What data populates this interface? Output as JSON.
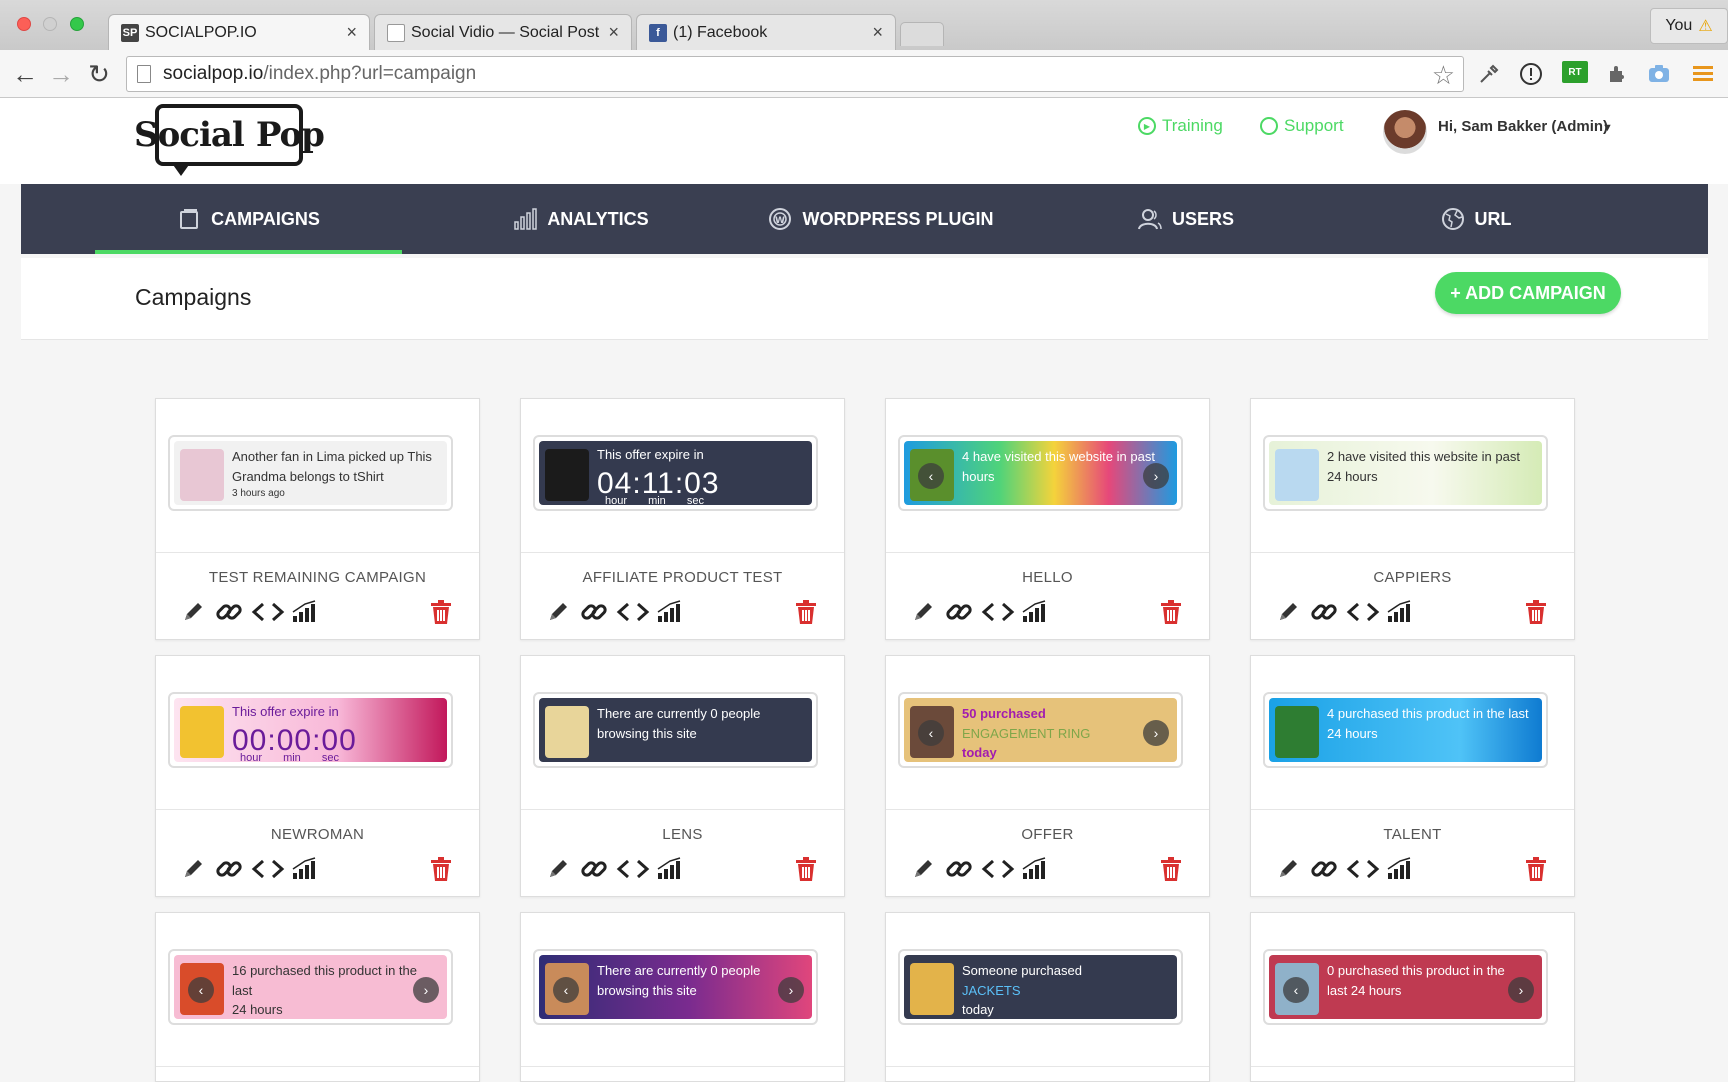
{
  "browser": {
    "tabs": [
      {
        "title": "SOCIALPOP.IO",
        "active": true
      },
      {
        "title": "Social Vidio — Social Post",
        "active": false
      },
      {
        "title": "(1) Facebook",
        "active": false
      }
    ],
    "profile_label": "You",
    "url_host": "socialpop.io",
    "url_path": "/index.php?url=campaign"
  },
  "header": {
    "logo_left": "Social",
    "logo_right": "Pop",
    "training_label": "Training",
    "support_label": "Support",
    "user_greeting": "Hi, Sam Bakker (Admin)"
  },
  "nav": {
    "items": [
      {
        "label": "CAMPAIGNS",
        "icon": "campaigns-icon",
        "active": true
      },
      {
        "label": "ANALYTICS",
        "icon": "bar-chart-icon",
        "active": false
      },
      {
        "label": "WORDPRESS PLUGIN",
        "icon": "wordpress-icon",
        "active": false
      },
      {
        "label": "USERS",
        "icon": "users-icon",
        "active": false
      },
      {
        "label": "URL",
        "icon": "globe-icon",
        "active": false
      }
    ]
  },
  "page": {
    "title": "Campaigns",
    "add_button": "+ ADD CAMPAIGN"
  },
  "colors": {
    "accent_green": "#4cd964",
    "nav_bg": "#3a3f51",
    "delete_red": "#d9302f"
  },
  "campaigns": [
    {
      "name": "TEST REMAINING CAMPAIGN",
      "preview": {
        "style": "light",
        "line1": "Another fan in Lima picked up This",
        "line2": "Grandma belongs to tShirt",
        "line3": "3 hours ago"
      }
    },
    {
      "name": "AFFILIATE PRODUCT TEST",
      "preview": {
        "style": "dark-timer",
        "line1": "This offer expire in",
        "timer": "04:11:03",
        "units": "hour min sec"
      }
    },
    {
      "name": "HELLO",
      "preview": {
        "style": "rainbow",
        "line1": "4 have visited this website in past",
        "line2": "hours"
      }
    },
    {
      "name": "CAPPIERS",
      "preview": {
        "style": "green-floral",
        "line1": "2 have visited this website in past",
        "line2": "24 hours"
      }
    },
    {
      "name": "NEWROMAN",
      "preview": {
        "style": "pink-timer",
        "line1": "This offer expire in",
        "timer": "00:00:00",
        "units": "hour min sec"
      }
    },
    {
      "name": "LENS",
      "preview": {
        "style": "dark",
        "line1": "There are currently 0 people",
        "line2": "browsing this site"
      }
    },
    {
      "name": "OFFER",
      "preview": {
        "style": "gold",
        "line1": "50 purchased",
        "line2": "ENGAGEMENT RING",
        "line3": "today"
      }
    },
    {
      "name": "TALENT",
      "preview": {
        "style": "blue-xmas",
        "line1": "4 purchased this product in the last",
        "line2": "24 hours"
      }
    },
    {
      "name": "",
      "preview": {
        "style": "pink-light",
        "line1": "16 purchased this product in the last",
        "line2": "24 hours"
      }
    },
    {
      "name": "",
      "preview": {
        "style": "purple-pink",
        "line1": "There are currently 0 people",
        "line2": "browsing this site"
      }
    },
    {
      "name": "",
      "preview": {
        "style": "dark-palette",
        "line1": "Someone purchased",
        "line2": "JACKETS",
        "line3": "today"
      }
    },
    {
      "name": "",
      "preview": {
        "style": "red-computer",
        "line1": "0 purchased this product in the",
        "line2": "last 24 hours"
      }
    }
  ]
}
